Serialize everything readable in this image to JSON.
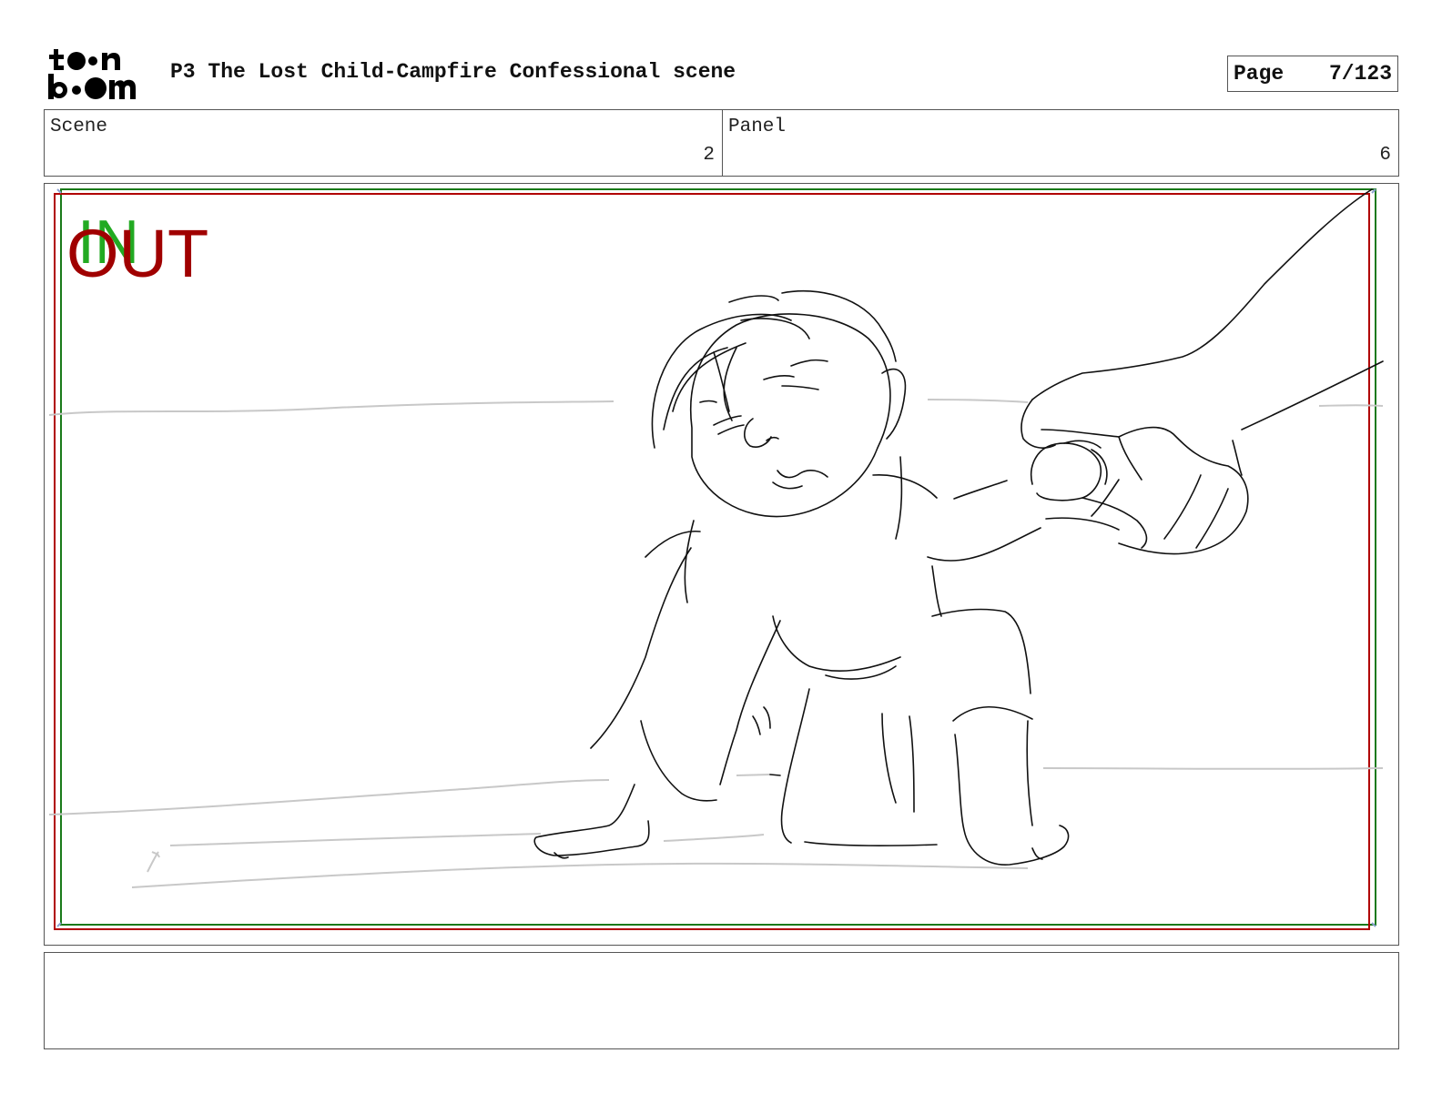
{
  "header": {
    "logo": {
      "line1": "toon",
      "line2": "boom"
    },
    "title": "P3 The Lost Child-Campfire Confessional scene",
    "page_label": "Page",
    "page_value": "7/123"
  },
  "info": {
    "scene_label": "Scene",
    "scene_value": "2",
    "panel_label": "Panel",
    "panel_value": "6"
  },
  "panel": {
    "in_label": "IN",
    "out_label": "OUT",
    "colors": {
      "in": "#22aa22",
      "out": "#a00000",
      "sketch": "#111111",
      "ground": "#c8c8c8"
    }
  },
  "notes": {
    "text": ""
  }
}
